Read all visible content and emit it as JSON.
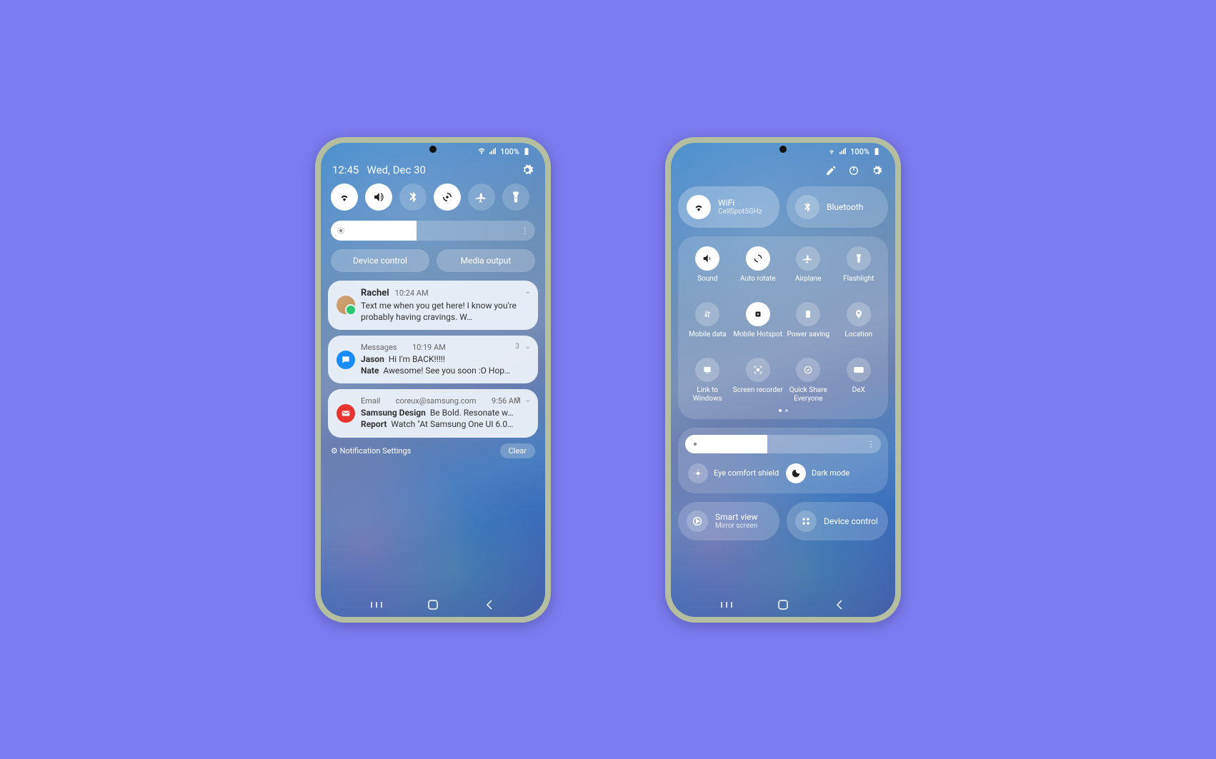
{
  "status": {
    "battery": "100%"
  },
  "phone1": {
    "time": "12:45",
    "date": "Wed, Dec 30",
    "device_control": "Device control",
    "media_output": "Media output",
    "notifications": [
      {
        "sender": "Rachel",
        "time": "10:24 AM",
        "preview": "Text me when you get here! I know you're probably having cravings. W…"
      },
      {
        "app": "Messages",
        "time": "10:19 AM",
        "count": "3",
        "line_a_sender": "Jason",
        "line_a_text": "Hi I'm BACK!!!!!",
        "line_b_sender": "Nate",
        "line_b_text": "Awesome! See you soon :O Hop…"
      },
      {
        "app": "Email",
        "from": "coreux@samsung.com",
        "time": "9:56 AM",
        "count": "4",
        "line_a_sender": "Samsung Design",
        "line_a_text": "Be Bold. Resonate w…",
        "line_b_sender": "Report",
        "line_b_text": "Watch \"At Samsung One UI 6.0…"
      }
    ],
    "settings_label": "Notification Settings",
    "clear_label": "Clear"
  },
  "phone2": {
    "wifi": {
      "label": "WiFi",
      "sub": "CellSpot5GHz"
    },
    "bluetooth": {
      "label": "Bluetooth"
    },
    "grid": {
      "sound": "Sound",
      "auto_rotate": "Auto rotate",
      "airplane": "Airplane",
      "flashlight": "Flashlight",
      "mobile_data": "Mobile data",
      "mobile_hotspot": "Mobile Hotspot",
      "power_saving": "Power saving",
      "location": "Location",
      "link_windows": "Link to Windows",
      "screen_recorder": "Screen recorder",
      "quick_share": "Quick Share",
      "quick_share_sub": "Everyone",
      "dex": "DeX"
    },
    "eye_comfort": "Eye comfort shield",
    "dark_mode": "Dark mode",
    "smart_view": {
      "label": "Smart view",
      "sub": "Mirror screen"
    },
    "device_control": "Device control"
  }
}
